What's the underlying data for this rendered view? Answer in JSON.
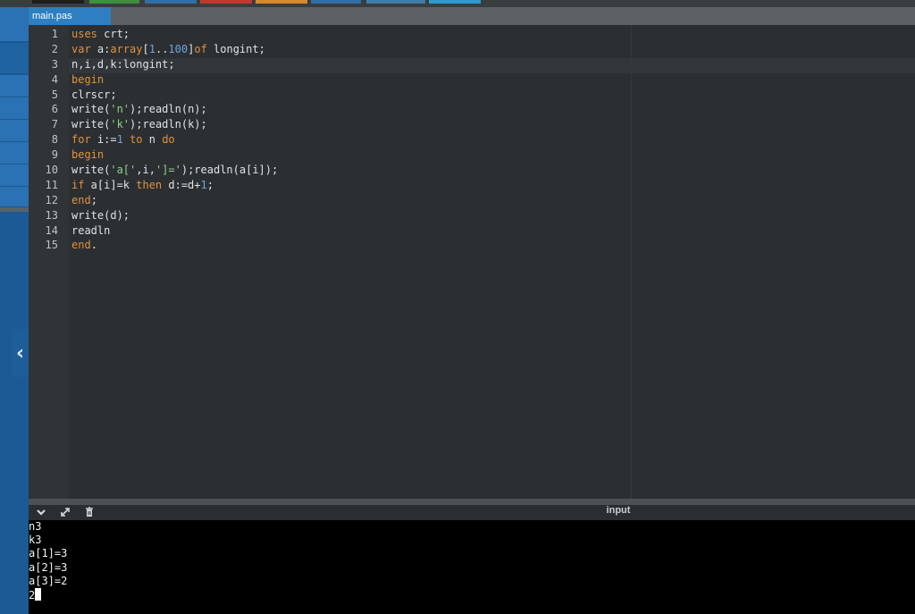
{
  "colors": {
    "sidebar": "#1b5a94",
    "tab_active": "#2d7fc1",
    "editor_bg": "#2c2f31",
    "keyword": "#e0913e",
    "string": "#8fd18b",
    "number": "#6fa3dd",
    "console_bg": "#000000"
  },
  "toolbar_colors": [
    "#1b1d1f",
    "#3f8f3f",
    "#2f6fa8",
    "#c0392b",
    "#d68a2a",
    "#2f6fa8",
    "#3d7ea8",
    "#2a9ad0"
  ],
  "tab": {
    "label": "main.pas"
  },
  "sidebar": {
    "collapse_icon": "chevron-left-icon",
    "collapse_glyph": "‹"
  },
  "editor": {
    "line_numbers": [
      "1",
      "2",
      "3",
      "4",
      "5",
      "6",
      "7",
      "8",
      "9",
      "10",
      "11",
      "12",
      "13",
      "14",
      "15"
    ],
    "lines": [
      [
        {
          "t": "uses",
          "c": "kw"
        },
        {
          "t": " crt;",
          "c": ""
        }
      ],
      [
        {
          "t": "var",
          "c": "kw"
        },
        {
          "t": " a:",
          "c": ""
        },
        {
          "t": "array",
          "c": "kw"
        },
        {
          "t": "[",
          "c": ""
        },
        {
          "t": "1",
          "c": "num"
        },
        {
          "t": "..",
          "c": ""
        },
        {
          "t": "100",
          "c": "num"
        },
        {
          "t": "]",
          "c": ""
        },
        {
          "t": "of",
          "c": "kw"
        },
        {
          "t": " longint;",
          "c": ""
        }
      ],
      [
        {
          "t": "n,i,d,k:longint;",
          "c": ""
        }
      ],
      [
        {
          "t": "begin",
          "c": "kw"
        }
      ],
      [
        {
          "t": "clrscr;",
          "c": ""
        }
      ],
      [
        {
          "t": "write(",
          "c": ""
        },
        {
          "t": "'n'",
          "c": "str"
        },
        {
          "t": ");readln(n);",
          "c": ""
        }
      ],
      [
        {
          "t": "write(",
          "c": ""
        },
        {
          "t": "'k'",
          "c": "str"
        },
        {
          "t": ");readln(k);",
          "c": ""
        }
      ],
      [
        {
          "t": "for",
          "c": "kw"
        },
        {
          "t": " i:=",
          "c": ""
        },
        {
          "t": "1",
          "c": "num"
        },
        {
          "t": " ",
          "c": ""
        },
        {
          "t": "to",
          "c": "kw"
        },
        {
          "t": " n ",
          "c": ""
        },
        {
          "t": "do",
          "c": "kw"
        }
      ],
      [
        {
          "t": "begin",
          "c": "kw"
        }
      ],
      [
        {
          "t": "write(",
          "c": ""
        },
        {
          "t": "'a['",
          "c": "str"
        },
        {
          "t": ",i,",
          "c": ""
        },
        {
          "t": "']='",
          "c": "str"
        },
        {
          "t": ");readln(a[i]);",
          "c": ""
        }
      ],
      [
        {
          "t": "if",
          "c": "kw"
        },
        {
          "t": " a[i]=k ",
          "c": ""
        },
        {
          "t": "then",
          "c": "kw"
        },
        {
          "t": " d:=d+",
          "c": ""
        },
        {
          "t": "1",
          "c": "num"
        },
        {
          "t": ";",
          "c": ""
        }
      ],
      [
        {
          "t": "end",
          "c": "kw"
        },
        {
          "t": ";",
          "c": ""
        }
      ],
      [
        {
          "t": "write(d);",
          "c": ""
        }
      ],
      [
        {
          "t": "readln",
          "c": ""
        }
      ],
      [
        {
          "t": "end",
          "c": "kw"
        },
        {
          "t": ".",
          "c": ""
        }
      ]
    ]
  },
  "console": {
    "title": "input",
    "toolbar_icons": [
      "chevron-down-icon",
      "expand-icon",
      "clear-console-icon"
    ],
    "output": [
      "n3",
      "k3",
      "a[1]=3",
      "a[2]=3",
      "a[3]=2",
      "2"
    ]
  }
}
